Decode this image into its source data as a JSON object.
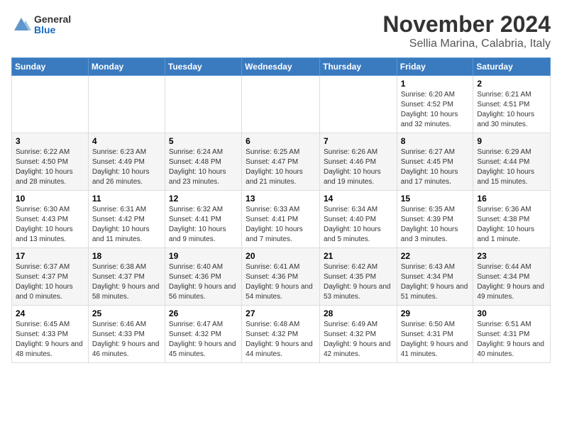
{
  "logo": {
    "general": "General",
    "blue": "Blue"
  },
  "title": "November 2024",
  "location": "Sellia Marina, Calabria, Italy",
  "days_header": [
    "Sunday",
    "Monday",
    "Tuesday",
    "Wednesday",
    "Thursday",
    "Friday",
    "Saturday"
  ],
  "weeks": [
    [
      {
        "day": "",
        "info": ""
      },
      {
        "day": "",
        "info": ""
      },
      {
        "day": "",
        "info": ""
      },
      {
        "day": "",
        "info": ""
      },
      {
        "day": "",
        "info": ""
      },
      {
        "day": "1",
        "info": "Sunrise: 6:20 AM\nSunset: 4:52 PM\nDaylight: 10 hours and 32 minutes."
      },
      {
        "day": "2",
        "info": "Sunrise: 6:21 AM\nSunset: 4:51 PM\nDaylight: 10 hours and 30 minutes."
      }
    ],
    [
      {
        "day": "3",
        "info": "Sunrise: 6:22 AM\nSunset: 4:50 PM\nDaylight: 10 hours and 28 minutes."
      },
      {
        "day": "4",
        "info": "Sunrise: 6:23 AM\nSunset: 4:49 PM\nDaylight: 10 hours and 26 minutes."
      },
      {
        "day": "5",
        "info": "Sunrise: 6:24 AM\nSunset: 4:48 PM\nDaylight: 10 hours and 23 minutes."
      },
      {
        "day": "6",
        "info": "Sunrise: 6:25 AM\nSunset: 4:47 PM\nDaylight: 10 hours and 21 minutes."
      },
      {
        "day": "7",
        "info": "Sunrise: 6:26 AM\nSunset: 4:46 PM\nDaylight: 10 hours and 19 minutes."
      },
      {
        "day": "8",
        "info": "Sunrise: 6:27 AM\nSunset: 4:45 PM\nDaylight: 10 hours and 17 minutes."
      },
      {
        "day": "9",
        "info": "Sunrise: 6:29 AM\nSunset: 4:44 PM\nDaylight: 10 hours and 15 minutes."
      }
    ],
    [
      {
        "day": "10",
        "info": "Sunrise: 6:30 AM\nSunset: 4:43 PM\nDaylight: 10 hours and 13 minutes."
      },
      {
        "day": "11",
        "info": "Sunrise: 6:31 AM\nSunset: 4:42 PM\nDaylight: 10 hours and 11 minutes."
      },
      {
        "day": "12",
        "info": "Sunrise: 6:32 AM\nSunset: 4:41 PM\nDaylight: 10 hours and 9 minutes."
      },
      {
        "day": "13",
        "info": "Sunrise: 6:33 AM\nSunset: 4:41 PM\nDaylight: 10 hours and 7 minutes."
      },
      {
        "day": "14",
        "info": "Sunrise: 6:34 AM\nSunset: 4:40 PM\nDaylight: 10 hours and 5 minutes."
      },
      {
        "day": "15",
        "info": "Sunrise: 6:35 AM\nSunset: 4:39 PM\nDaylight: 10 hours and 3 minutes."
      },
      {
        "day": "16",
        "info": "Sunrise: 6:36 AM\nSunset: 4:38 PM\nDaylight: 10 hours and 1 minute."
      }
    ],
    [
      {
        "day": "17",
        "info": "Sunrise: 6:37 AM\nSunset: 4:37 PM\nDaylight: 10 hours and 0 minutes."
      },
      {
        "day": "18",
        "info": "Sunrise: 6:38 AM\nSunset: 4:37 PM\nDaylight: 9 hours and 58 minutes."
      },
      {
        "day": "19",
        "info": "Sunrise: 6:40 AM\nSunset: 4:36 PM\nDaylight: 9 hours and 56 minutes."
      },
      {
        "day": "20",
        "info": "Sunrise: 6:41 AM\nSunset: 4:36 PM\nDaylight: 9 hours and 54 minutes."
      },
      {
        "day": "21",
        "info": "Sunrise: 6:42 AM\nSunset: 4:35 PM\nDaylight: 9 hours and 53 minutes."
      },
      {
        "day": "22",
        "info": "Sunrise: 6:43 AM\nSunset: 4:34 PM\nDaylight: 9 hours and 51 minutes."
      },
      {
        "day": "23",
        "info": "Sunrise: 6:44 AM\nSunset: 4:34 PM\nDaylight: 9 hours and 49 minutes."
      }
    ],
    [
      {
        "day": "24",
        "info": "Sunrise: 6:45 AM\nSunset: 4:33 PM\nDaylight: 9 hours and 48 minutes."
      },
      {
        "day": "25",
        "info": "Sunrise: 6:46 AM\nSunset: 4:33 PM\nDaylight: 9 hours and 46 minutes."
      },
      {
        "day": "26",
        "info": "Sunrise: 6:47 AM\nSunset: 4:32 PM\nDaylight: 9 hours and 45 minutes."
      },
      {
        "day": "27",
        "info": "Sunrise: 6:48 AM\nSunset: 4:32 PM\nDaylight: 9 hours and 44 minutes."
      },
      {
        "day": "28",
        "info": "Sunrise: 6:49 AM\nSunset: 4:32 PM\nDaylight: 9 hours and 42 minutes."
      },
      {
        "day": "29",
        "info": "Sunrise: 6:50 AM\nSunset: 4:31 PM\nDaylight: 9 hours and 41 minutes."
      },
      {
        "day": "30",
        "info": "Sunrise: 6:51 AM\nSunset: 4:31 PM\nDaylight: 9 hours and 40 minutes."
      }
    ]
  ]
}
